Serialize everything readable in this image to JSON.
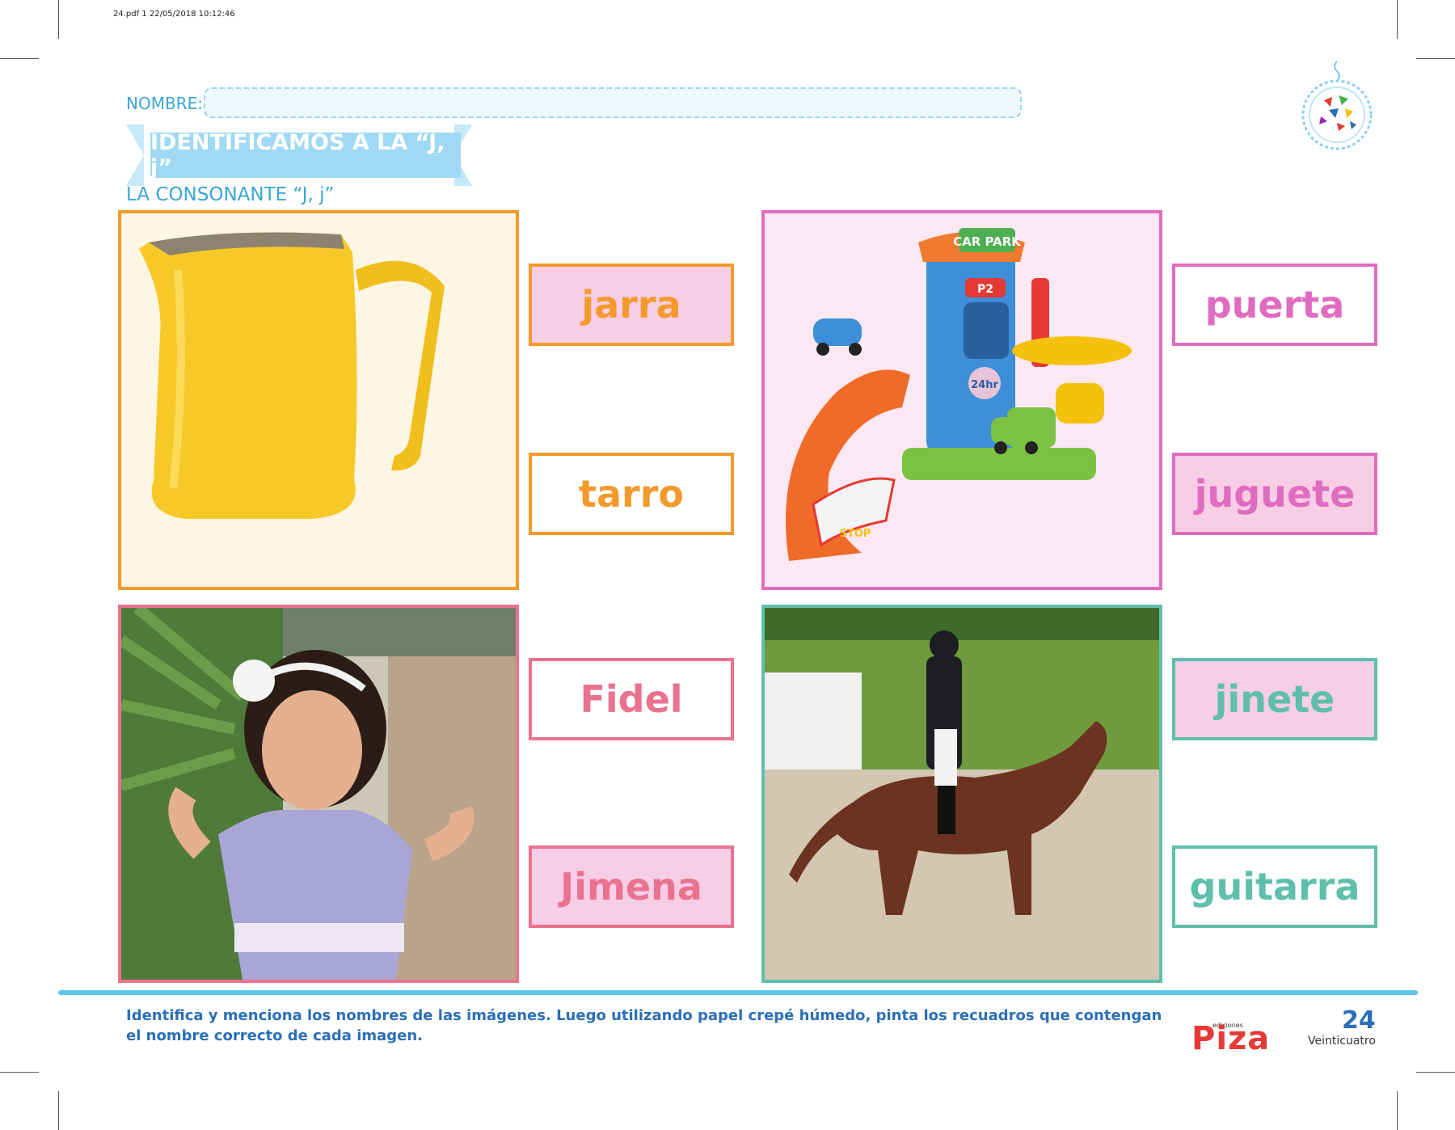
{
  "header": {
    "pdf_info": "24.pdf  1  22/05/2018  10:12:46",
    "name_label": "NOMBRE:",
    "banner_title": "IDENTIFICAMOS A LA “J, j”",
    "subtitle": "LA CONSONANTE “J, j”"
  },
  "items": [
    {
      "options": [
        "jarra",
        "tarro"
      ],
      "accent": "#f39a2c",
      "filled_option": 0
    },
    {
      "options": [
        "puerta",
        "juguete"
      ],
      "accent": "#e06cc0",
      "filled_option": 1
    },
    {
      "options": [
        "Fidel",
        "Jimena"
      ],
      "accent": "#e9738f",
      "filled_option": 1
    },
    {
      "options": [
        "jinete",
        "guitarra"
      ],
      "accent": "#5fbfac",
      "filled_option": 0
    }
  ],
  "toy_labels": {
    "sign": "CAR PARK",
    "level": "P2",
    "hours": "24hr",
    "stop": "STOP"
  },
  "footer": {
    "instructions": "Identifica y menciona los nombres de las imágenes. Luego utilizando papel crepé húmedo, pinta los recuadros que contengan el nombre correcto de cada imagen.",
    "brand_small": "ediciones",
    "brand": "Piza",
    "page_number": "24",
    "page_word": "Veinticuatro"
  },
  "colors": {
    "fill_pink": "#f8cde6",
    "blue_text": "#2a6fb8",
    "heading_blue": "#3aa6d6"
  }
}
